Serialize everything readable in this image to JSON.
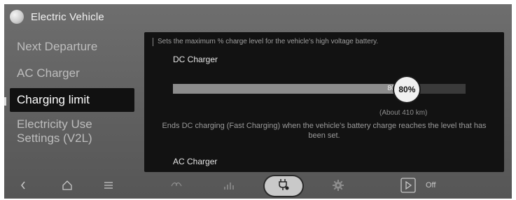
{
  "app": {
    "title": "Electric Vehicle",
    "icon": "moon-icon"
  },
  "sidebar": {
    "items": [
      {
        "label": "Next Departure"
      },
      {
        "label": "AC Charger"
      },
      {
        "label": "Charging limit"
      },
      {
        "label": "Electricity Use Settings (V2L)"
      }
    ],
    "active_index": 2
  },
  "panel": {
    "description": "Sets the maximum % charge level for the vehicle's high voltage battery.",
    "dc_title": "DC Charger",
    "dc_fill_label": "80%",
    "dc_thumb_label": "80%",
    "dc_level_fraction": 0.8,
    "range_text": "(About 410 km)",
    "explanation": "Ends DC charging (Fast Charging) when the vehicle's battery charge reaches the level that has been set.",
    "ac_title": "AC Charger"
  },
  "bottom_bar": {
    "icons": [
      "back-icon",
      "home-icon",
      "menu-icon",
      "eco-leaf-icon",
      "energy-chart-icon",
      "charging-plug-icon",
      "gear-icon",
      "play-icon"
    ],
    "off_label": "Off"
  },
  "colors": {
    "background": "#656565",
    "panel": "#121212",
    "active_item": "#111111",
    "thumb": "#f0f0f0"
  }
}
